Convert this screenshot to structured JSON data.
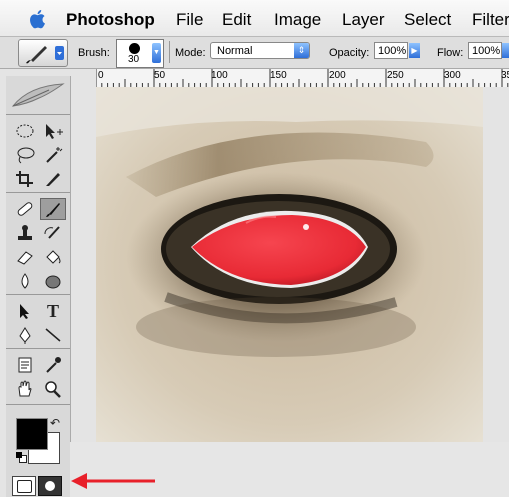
{
  "menubar": {
    "app_name": "Photoshop",
    "items": [
      "File",
      "Edit",
      "Image",
      "Layer",
      "Select",
      "Filter"
    ]
  },
  "options": {
    "brush_label": "Brush:",
    "brush_size": "30",
    "mode_label": "Mode:",
    "mode_value": "Normal",
    "opacity_label": "Opacity:",
    "opacity_value": "100%",
    "flow_label": "Flow:",
    "flow_value": "100%"
  },
  "ruler": {
    "ticks": [
      "0",
      "50",
      "100",
      "150",
      "200",
      "250",
      "300",
      "35"
    ]
  },
  "toolbox": {
    "tool_icons": [
      "feather-logo",
      "marquee-icon",
      "move-icon",
      "lasso-icon",
      "magic-wand-icon",
      "crop-icon",
      "slice-icon",
      "healing-brush-icon",
      "brush-icon",
      "clone-stamp-icon",
      "history-brush-icon",
      "eraser-icon",
      "paint-bucket-icon",
      "blur-icon",
      "dodge-icon",
      "path-selection-icon",
      "type-icon",
      "pen-icon",
      "line-icon",
      "notes-icon",
      "eyedropper-icon",
      "hand-icon",
      "zoom-icon"
    ],
    "type_tool_glyph": "T"
  },
  "colors": {
    "eye_red": "#e82a35",
    "annotation_arrow": "#e8202a",
    "foreground": "#000000",
    "background": "#ffffff"
  }
}
